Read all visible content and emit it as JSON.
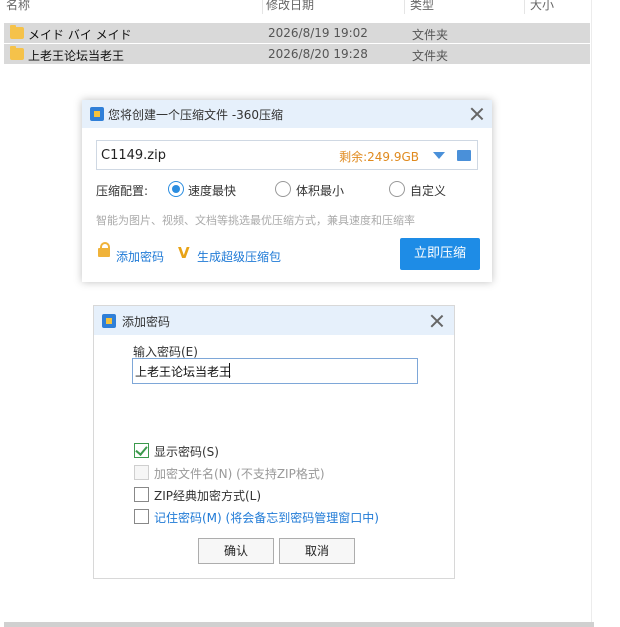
{
  "explorer": {
    "columns": {
      "name": "名称",
      "date": "修改日期",
      "type": "类型",
      "size": "大小"
    },
    "rows": [
      {
        "name": "メイド バイ メイド",
        "date": "2026/8/19 19:02",
        "type": "文件夹"
      },
      {
        "name": "上老王论坛当老王",
        "date": "2026/8/20 19:28",
        "type": "文件夹"
      }
    ]
  },
  "compress": {
    "title": "您将创建一个压缩文件 -360压缩",
    "filename": "C1149.zip",
    "free_space": "剩余:249.9GB",
    "config_label": "压缩配置:",
    "options": [
      {
        "label": "速度最快",
        "selected": true
      },
      {
        "label": "体积最小",
        "selected": false
      },
      {
        "label": "自定义",
        "selected": false
      }
    ],
    "hint": "智能为图片、视频、文档等挑选最优压缩方式，兼具速度和压缩率",
    "add_password": "添加密码",
    "super_pack": "生成超级压缩包",
    "start_button": "立即压缩"
  },
  "password": {
    "title": "添加密码",
    "input_label": "输入密码(E)",
    "input_value": "上老王论坛当老王",
    "checks": [
      {
        "label": "显示密码(S)",
        "checked": true,
        "disabled": false
      },
      {
        "label": "加密文件名(N) (不支持ZIP格式)",
        "checked": false,
        "disabled": true
      },
      {
        "label": "ZIP经典加密方式(L)",
        "checked": false,
        "disabled": false
      },
      {
        "label": "记住密码(M) (将会备忘到密码管理窗口中)",
        "checked": false,
        "disabled": false
      }
    ],
    "ok_button": "确认",
    "cancel_button": "取消"
  },
  "colors": {
    "accent": "#1e8ce6",
    "free_space": "#e08a1e",
    "title_bar": "#e6f0fb"
  }
}
